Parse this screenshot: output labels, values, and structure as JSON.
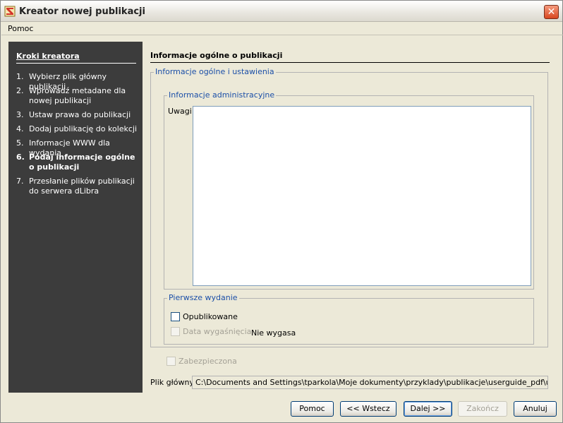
{
  "window": {
    "title": "Kreator nowej publikacji",
    "close_label": "✕"
  },
  "menu": {
    "help": "Pomoc"
  },
  "sidebar": {
    "title": "Kroki kreatora",
    "steps": [
      {
        "num": "1.",
        "label": "Wybierz plik główny publikacji"
      },
      {
        "num": "2.",
        "label": "Wprowadź metadane dla nowej publikacji"
      },
      {
        "num": "3.",
        "label": "Ustaw prawa do publikacji"
      },
      {
        "num": "4.",
        "label": "Dodaj publikację do kolekcji"
      },
      {
        "num": "5.",
        "label": "Informacje WWW dla wydania"
      },
      {
        "num": "6.",
        "label": "Podaj informacje ogólne o publikacji"
      },
      {
        "num": "7.",
        "label": "Przesłanie plików publikacji do serwera dLibra"
      }
    ],
    "active_step": 6
  },
  "main": {
    "heading": "Informacje ogólne o publikacji",
    "general_group": "Informacje ogólne i ustawienia",
    "admin_group": "Informacje administracyjne",
    "notes_label": "Uwagi",
    "notes_value": "",
    "first_edition_group": "Pierwsze wydanie",
    "published_label": "Opublikowane",
    "published_checked": false,
    "expiry_label": "Data wygaśnięcia",
    "expiry_value": "Nie wygasa",
    "secured_label": "Zabezpieczona",
    "main_file_label": "Plik główny",
    "main_file_value": "C:\\Documents and Settings\\tparkola\\Moje dokumenty\\przyklady\\publikacje\\userguide_pdf\\userguide.pdf"
  },
  "buttons": {
    "help": "Pomoc",
    "back": "<< Wstecz",
    "next": "Dalej >>",
    "finish": "Zakończ",
    "cancel": "Anuluj"
  },
  "colors": {
    "sidebar_bg": "#3c3c3c",
    "legend_text": "#1b4fa8",
    "window_bg": "#ece9d8"
  }
}
